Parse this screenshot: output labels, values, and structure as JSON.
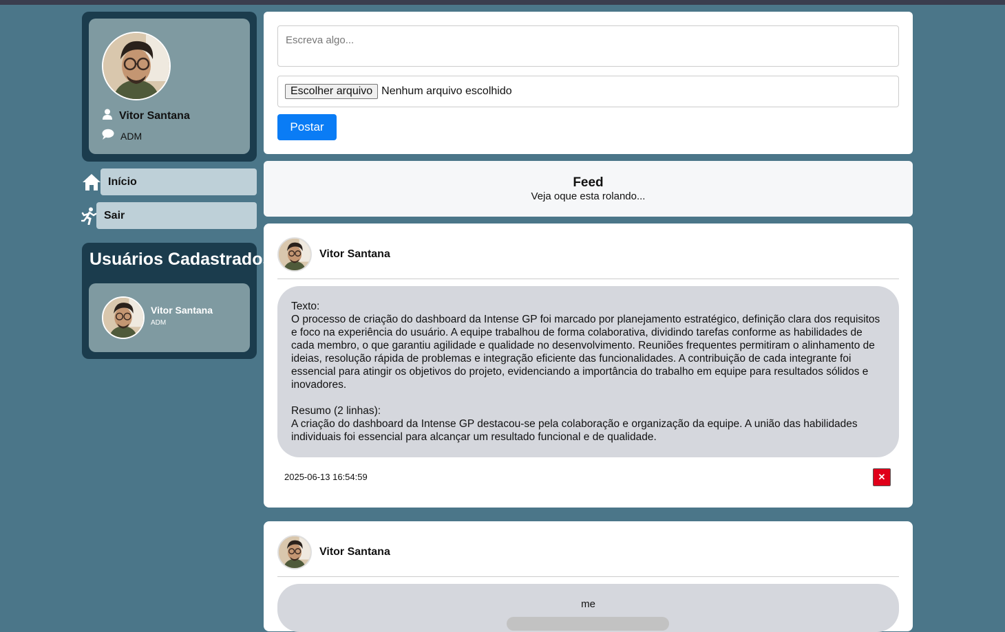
{
  "sidebar": {
    "profile": {
      "name": "Vitor Santana",
      "role": "ADM"
    },
    "nav": [
      {
        "label": "Início",
        "icon": "home-icon"
      },
      {
        "label": "Sair",
        "icon": "running-exit-icon"
      }
    ],
    "users_panel": {
      "title": "Usuários Cadastrados",
      "users": [
        {
          "name": "Vitor Santana",
          "role": "ADM"
        }
      ]
    }
  },
  "composer": {
    "placeholder": "Escreva algo...",
    "file_button": "Escolher arquivo",
    "file_status": "Nenhum arquivo escolhido",
    "submit_label": "Postar"
  },
  "feed": {
    "title": "Feed",
    "subtitle": "Veja oque esta rolando..."
  },
  "posts": [
    {
      "author": "Vitor Santana",
      "text": "Texto:\nO processo de criação do dashboard da Intense GP foi marcado por planejamento estratégico, definição clara dos requisitos e foco na experiência do usuário. A equipe trabalhou de forma colaborativa, dividindo tarefas conforme as habilidades de cada membro, o que garantiu agilidade e qualidade no desenvolvimento. Reuniões frequentes permitiram o alinhamento de ideias, resolução rápida de problemas e integração eficiente das funcionalidades. A contribuição de cada integrante foi essencial para atingir os objetivos do projeto, evidenciando a importância do trabalho em equipe para resultados sólidos e inovadores.\n\nResumo (2 linhas):\nA criação do dashboard da Intense GP destacou-se pela colaboração e organização da equipe. A união das habilidades individuais foi essencial para alcançar um resultado funcional e de qualidade.",
      "date": "2025-06-13 16:54:59",
      "delete_icon": "close-icon"
    },
    {
      "author": "Vitor Santana",
      "text": "me"
    }
  ],
  "colors": {
    "background": "#4b7689",
    "panel_dark": "#1b3c4d",
    "card": "#7f9aa1",
    "nav_button": "#bed0d8",
    "primary": "#0a7cf5",
    "danger": "#e0001a"
  }
}
